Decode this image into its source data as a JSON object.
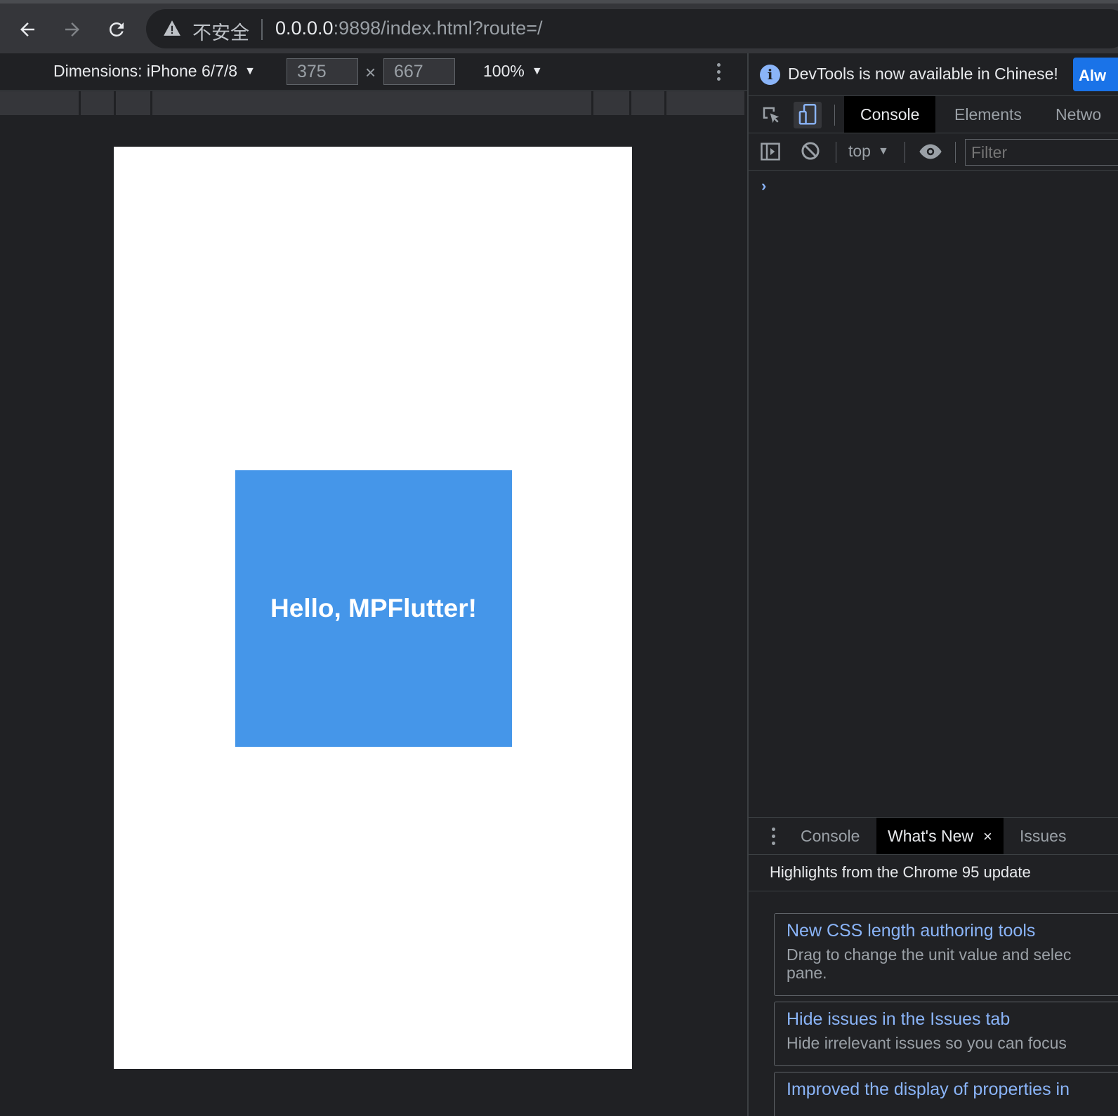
{
  "browser": {
    "insecure_label": "不安全",
    "url_host": "0.0.0.0",
    "url_rest": ":9898/index.html?route=/"
  },
  "device_toolbar": {
    "dimensions_label": "Dimensions: iPhone 6/7/8",
    "width": "375",
    "times": "×",
    "height": "667",
    "zoom": "100%"
  },
  "page": {
    "hello_text": "Hello, MPFlutter!",
    "box_color": "#4596e9"
  },
  "devtools": {
    "infobar": {
      "message": "DevTools is now available in Chinese!",
      "button": "Alw"
    },
    "tabs": [
      "Console",
      "Elements",
      "Netwo"
    ],
    "active_tab": "Console",
    "console": {
      "context": "top",
      "filter_placeholder": "Filter",
      "prompt": "›"
    },
    "drawer": {
      "tabs": [
        {
          "label": "Console"
        },
        {
          "label": "What's New"
        },
        {
          "label": "Issues"
        }
      ],
      "close": "×",
      "highlights": "Highlights from the Chrome 95 update",
      "cards": [
        {
          "title": "New CSS length authoring tools",
          "desc_line1": "Drag to change the unit value and selec",
          "desc_line2": "pane."
        },
        {
          "title": "Hide issues in the Issues tab",
          "desc_line1": "Hide irrelevant issues so you can focus"
        },
        {
          "title": "Improved the display of properties in"
        }
      ]
    }
  },
  "icons": {
    "back": "arrow-left-icon",
    "forward": "arrow-right-icon",
    "reload": "reload-icon",
    "warning": "warning-triangle-icon",
    "info": "info-icon",
    "inspect": "inspect-element-icon",
    "device": "device-toolbar-icon",
    "sidebar": "sidebar-toggle-icon",
    "clear": "clear-console-icon",
    "eye": "live-expression-icon"
  }
}
